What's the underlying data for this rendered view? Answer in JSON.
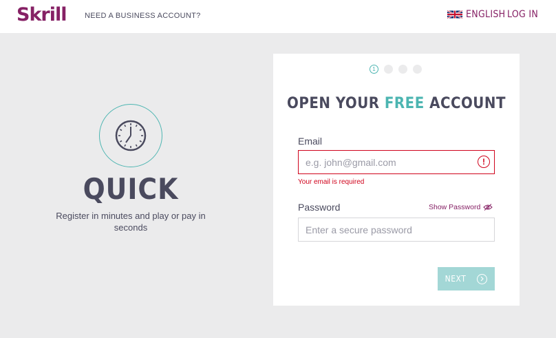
{
  "header": {
    "logo": "Skrill",
    "business_link": "NEED A BUSINESS ACCOUNT?",
    "language": "ENGLISH",
    "login": "LOG IN"
  },
  "promo": {
    "icon": "clock-icon",
    "title": "QUICK",
    "text": "Register in minutes and play or pay in seconds"
  },
  "form": {
    "steps": {
      "current": 1,
      "total": 4,
      "current_label": "1"
    },
    "title_part1": "OPEN YOUR ",
    "title_accent": "FREE",
    "title_part2": " ACCOUNT",
    "email_label": "Email",
    "email_placeholder": "e.g. john@gmail.com",
    "email_value": "",
    "email_error": "Your email is required",
    "error_icon_glyph": "!",
    "password_label": "Password",
    "show_password": "Show Password",
    "password_placeholder": "Enter a secure password",
    "password_value": "",
    "next_label": "NEXT"
  },
  "colors": {
    "brand": "#862165",
    "accent": "#4cb5b1",
    "error": "#d0021b",
    "text": "#4a4a5e",
    "button_disabled": "#a3d7d6",
    "background": "#ebebec"
  }
}
